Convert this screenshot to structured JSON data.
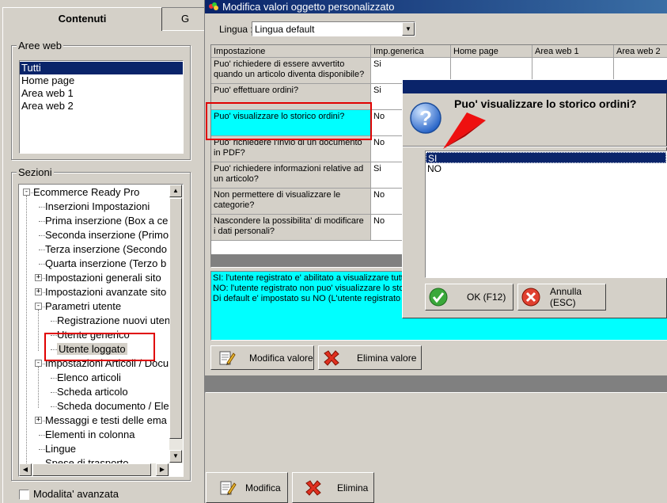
{
  "left_panel": {
    "tabs": [
      {
        "label": "Contenuti"
      },
      {
        "label": "G"
      }
    ],
    "aree_web": {
      "label": "Aree web",
      "items": [
        {
          "label": "Tutti",
          "selected": true
        },
        {
          "label": "Home page"
        },
        {
          "label": "Area web 1"
        },
        {
          "label": "Area web 2"
        }
      ]
    },
    "sezioni": {
      "label": "Sezioni",
      "tree": [
        {
          "label": "Ecommerce Ready Pro",
          "level": 0,
          "expander": "-"
        },
        {
          "label": "Inserzioni Impostazioni",
          "level": 1
        },
        {
          "label": "Prima inserzione (Box a ce",
          "level": 1
        },
        {
          "label": "Seconda inserzione (Primo",
          "level": 1
        },
        {
          "label": "Terza inserzione (Secondo",
          "level": 1
        },
        {
          "label": "Quarta inserzione (Terzo b",
          "level": 1
        },
        {
          "label": "Impostazioni generali sito",
          "level": 1,
          "expander": "+"
        },
        {
          "label": "Impostazioni avanzate sito",
          "level": 1,
          "expander": "+"
        },
        {
          "label": "Parametri utente",
          "level": 1,
          "expander": "-"
        },
        {
          "label": "Registrazione nuovi uten",
          "level": 2
        },
        {
          "label": "Utente generico",
          "level": 2
        },
        {
          "label": "Utente loggato",
          "level": 2,
          "selected": true
        },
        {
          "label": "Impostazioni Articoli / Docu",
          "level": 1,
          "expander": "-"
        },
        {
          "label": "Elenco articoli",
          "level": 2
        },
        {
          "label": "Scheda articolo",
          "level": 2
        },
        {
          "label": "Scheda documento / Ele",
          "level": 2
        },
        {
          "label": "Messaggi e testi delle ema",
          "level": 1,
          "expander": "+"
        },
        {
          "label": "Elementi in colonna",
          "level": 1
        },
        {
          "label": "Lingue",
          "level": 1
        },
        {
          "label": "Spese di trasporto",
          "level": 1
        }
      ]
    },
    "advanced_mode": {
      "label": "Modalita' avanzata",
      "checked": false
    }
  },
  "main_window": {
    "title": "Modifica valori oggetto personalizzato",
    "lingua": {
      "label": "Lingua :",
      "value": "Lingua default"
    },
    "grid": {
      "columns": [
        "Impostazione",
        "Imp.generica",
        "Home page",
        "Area web 1",
        "Area web 2"
      ],
      "rows": [
        {
          "setting": "Puo' richiedere di essere avvertito quando un articolo diventa disponibile?",
          "value": "Si"
        },
        {
          "setting": "Puo' effettuare ordini?",
          "value": "Si"
        },
        {
          "setting": "Puo' visualizzare lo storico ordini?",
          "value": "No",
          "selected": true
        },
        {
          "setting": "Puo' richiedere l'invio di un documento in PDF?",
          "value": "No"
        },
        {
          "setting": "Puo' richiedere informazioni relative ad un articolo?",
          "value": "Si"
        },
        {
          "setting": "Non permettere di visualizzare le categorie?",
          "value": "No"
        },
        {
          "setting": "Nascondere la possibilita' di modificare i dati personali?",
          "value": "No"
        }
      ]
    },
    "description": [
      "SI: l'utente registrato e' abilitato a visualizzare tutto",
      "NO: l'utente registrato non puo' visualizzare lo stori",
      "Di default e' impostato su NO (L'utente registrato n"
    ],
    "buttons": {
      "modifica_valore": "Modifica valore",
      "elimina_valore": "Elimina valore"
    }
  },
  "bottom_buttons": {
    "modifica": "Modifica",
    "elimina": "Elimina"
  },
  "dialog": {
    "question": "Puo' visualizzare lo storico ordini?",
    "options": [
      {
        "label": "SI",
        "selected": true
      },
      {
        "label": "NO"
      }
    ],
    "ok": "OK (F12)",
    "cancel": "Annulla (ESC)"
  },
  "colors": {
    "highlight": "#0a246a",
    "selected_cell": "#00ffff",
    "annotation": "#e00000"
  }
}
